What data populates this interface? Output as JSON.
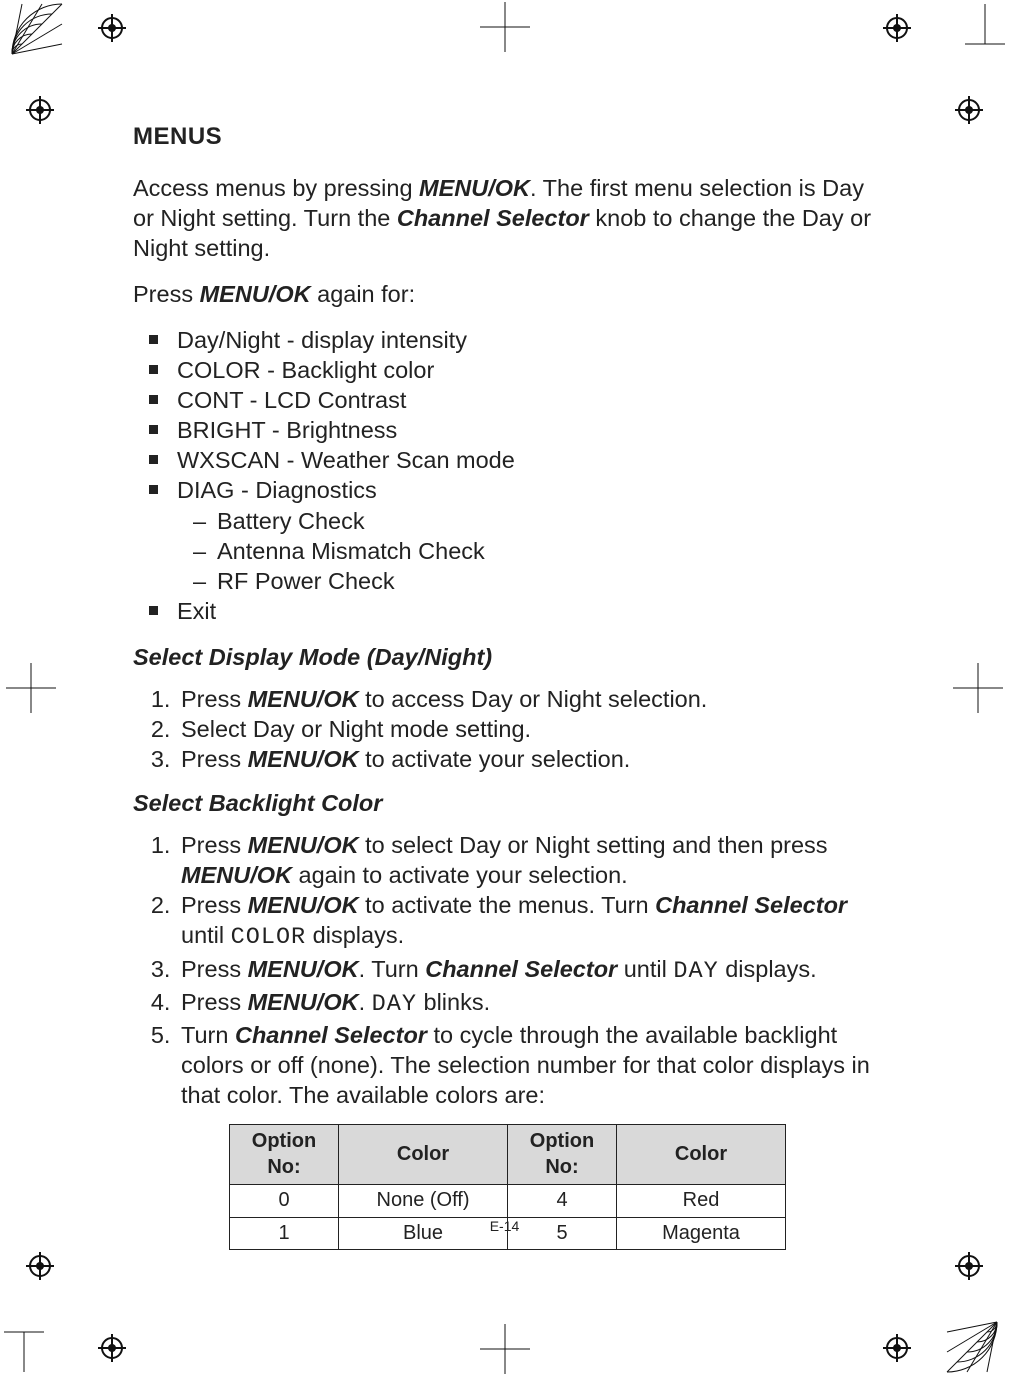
{
  "page": {
    "heading": "MENUS",
    "intro_1a": "Access menus by pressing ",
    "intro_menuok": "MENU/OK",
    "intro_1b": ". The first menu selection is Day or Night setting.  Turn the ",
    "intro_chsel": "Channel Selector",
    "intro_1c": " knob to change the Day or Night setting.",
    "intro_2a": "Press ",
    "intro_2b": " again for:",
    "menu_items": {
      "i0": "Day/Night - display intensity",
      "i1": "COLOR - Backlight color",
      "i2": "CONT - LCD Contrast",
      "i3": "BRIGHT - Brightness",
      "i4": "WXSCAN - Weather Scan mode",
      "i5": "DIAG - Diagnostics",
      "i5_sub": {
        "s0": "Battery Check",
        "s1": "Antenna Mismatch Check",
        "s2": "RF Power Check"
      },
      "i6": "Exit"
    },
    "sec1_head": "Select Display Mode (Day/Night)",
    "sec1": {
      "l1a": "Press ",
      "l1b": " to access Day or Night selection.",
      "l2": "Select Day or Night mode setting.",
      "l3a": "Press ",
      "l3b": "  to activate your selection."
    },
    "sec2_head": "Select Backlight Color",
    "sec2": {
      "l1a": "Press ",
      "l1b": " to select Day or Night setting and then press ",
      "l1c": "  again to activate your selection.",
      "l2a": "Press ",
      "l2b": " to activate the menus. Turn ",
      "l2c": " until ",
      "l2_seg": "COLOR",
      "l2d": " displays.",
      "l3a": "Press ",
      "l3b": ". Turn ",
      "l3c": " until ",
      "l3_seg": "DAY",
      "l3d": " displays.",
      "l4a": "Press ",
      "l4b": ". ",
      "l4_seg": "DAY",
      "l4c": " blinks.",
      "l5a": "Turn ",
      "l5b": " to cycle through the available backlight colors or off (none). The selection number for that color displays in that color. The available colors are:"
    },
    "table": {
      "h_opt": "Option No:",
      "h_col": "Color",
      "rows": [
        {
          "a": "0",
          "b": "None (Off)",
          "c": "4",
          "d": "Red"
        },
        {
          "a": "1",
          "b": "Blue",
          "c": "5",
          "d": "Magenta"
        }
      ]
    },
    "footer": "E-14"
  }
}
